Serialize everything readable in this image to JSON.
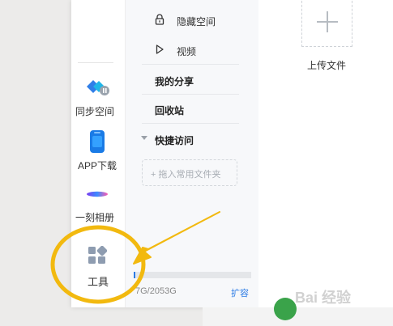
{
  "rail": {
    "items": [
      {
        "label": "同步空间",
        "icon": "sync-icon"
      },
      {
        "label": "APP下载",
        "icon": "phone-icon"
      },
      {
        "label": "一刻相册",
        "icon": "album-icon"
      },
      {
        "label": "工具",
        "icon": "tools-grid-icon"
      }
    ]
  },
  "nav": {
    "hidden_space": "隐藏空间",
    "video": "视频",
    "my_share": "我的分享",
    "recycle_bin": "回收站",
    "quick_access": "快捷访问",
    "drag_hint": "+ 拖入常用文件夹",
    "storage_text": "7G/2053G",
    "expand_label": "扩容",
    "storage_used_fraction": 0.004
  },
  "main": {
    "upload_label": "上传文件"
  },
  "watermark": {
    "text": "Bai 经验"
  },
  "colors": {
    "annotation": "#f2b90f",
    "accent_blue": "#2c7be5"
  }
}
